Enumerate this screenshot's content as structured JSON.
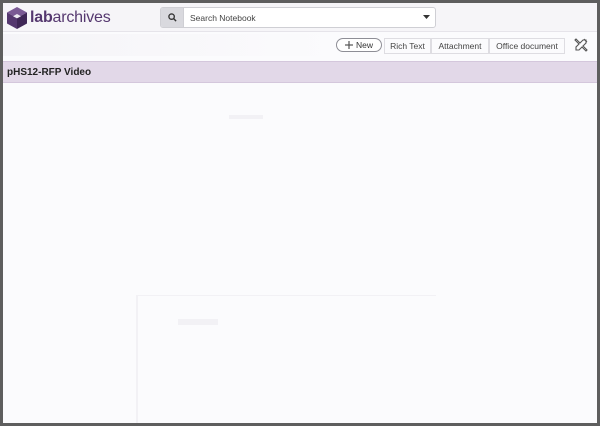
{
  "app": {
    "logo_text_bold": "lab",
    "logo_text_rest": "archives"
  },
  "search": {
    "placeholder": "Search Notebook"
  },
  "toolbar": {
    "new_label": "New",
    "buttons": [
      "Rich Text",
      "Attachment",
      "Office document"
    ]
  },
  "page": {
    "title": "pHS12-RFP Video"
  },
  "colors": {
    "brand": "#55386f",
    "title_bar": "#e2d8e8"
  },
  "icons": {
    "search": "search-icon",
    "dropdown": "chevron-down-icon",
    "plus": "plus-icon",
    "tools": "tools-icon"
  }
}
